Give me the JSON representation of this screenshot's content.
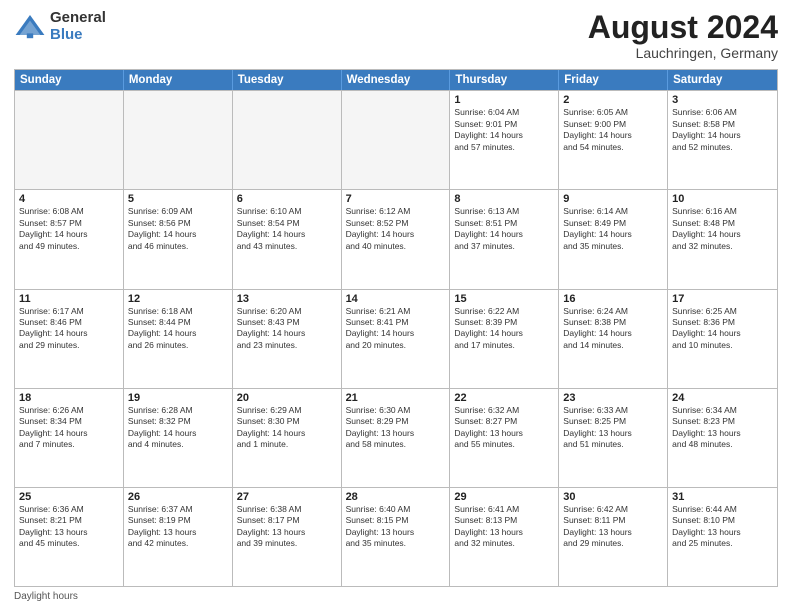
{
  "logo": {
    "general": "General",
    "blue": "Blue"
  },
  "title": {
    "month_year": "August 2024",
    "location": "Lauchringen, Germany"
  },
  "header_days": [
    "Sunday",
    "Monday",
    "Tuesday",
    "Wednesday",
    "Thursday",
    "Friday",
    "Saturday"
  ],
  "weeks": [
    [
      {
        "day": "",
        "info": "",
        "empty": true
      },
      {
        "day": "",
        "info": "",
        "empty": true
      },
      {
        "day": "",
        "info": "",
        "empty": true
      },
      {
        "day": "",
        "info": "",
        "empty": true
      },
      {
        "day": "1",
        "info": "Sunrise: 6:04 AM\nSunset: 9:01 PM\nDaylight: 14 hours\nand 57 minutes."
      },
      {
        "day": "2",
        "info": "Sunrise: 6:05 AM\nSunset: 9:00 PM\nDaylight: 14 hours\nand 54 minutes."
      },
      {
        "day": "3",
        "info": "Sunrise: 6:06 AM\nSunset: 8:58 PM\nDaylight: 14 hours\nand 52 minutes."
      }
    ],
    [
      {
        "day": "4",
        "info": "Sunrise: 6:08 AM\nSunset: 8:57 PM\nDaylight: 14 hours\nand 49 minutes."
      },
      {
        "day": "5",
        "info": "Sunrise: 6:09 AM\nSunset: 8:56 PM\nDaylight: 14 hours\nand 46 minutes."
      },
      {
        "day": "6",
        "info": "Sunrise: 6:10 AM\nSunset: 8:54 PM\nDaylight: 14 hours\nand 43 minutes."
      },
      {
        "day": "7",
        "info": "Sunrise: 6:12 AM\nSunset: 8:52 PM\nDaylight: 14 hours\nand 40 minutes."
      },
      {
        "day": "8",
        "info": "Sunrise: 6:13 AM\nSunset: 8:51 PM\nDaylight: 14 hours\nand 37 minutes."
      },
      {
        "day": "9",
        "info": "Sunrise: 6:14 AM\nSunset: 8:49 PM\nDaylight: 14 hours\nand 35 minutes."
      },
      {
        "day": "10",
        "info": "Sunrise: 6:16 AM\nSunset: 8:48 PM\nDaylight: 14 hours\nand 32 minutes."
      }
    ],
    [
      {
        "day": "11",
        "info": "Sunrise: 6:17 AM\nSunset: 8:46 PM\nDaylight: 14 hours\nand 29 minutes."
      },
      {
        "day": "12",
        "info": "Sunrise: 6:18 AM\nSunset: 8:44 PM\nDaylight: 14 hours\nand 26 minutes."
      },
      {
        "day": "13",
        "info": "Sunrise: 6:20 AM\nSunset: 8:43 PM\nDaylight: 14 hours\nand 23 minutes."
      },
      {
        "day": "14",
        "info": "Sunrise: 6:21 AM\nSunset: 8:41 PM\nDaylight: 14 hours\nand 20 minutes."
      },
      {
        "day": "15",
        "info": "Sunrise: 6:22 AM\nSunset: 8:39 PM\nDaylight: 14 hours\nand 17 minutes."
      },
      {
        "day": "16",
        "info": "Sunrise: 6:24 AM\nSunset: 8:38 PM\nDaylight: 14 hours\nand 14 minutes."
      },
      {
        "day": "17",
        "info": "Sunrise: 6:25 AM\nSunset: 8:36 PM\nDaylight: 14 hours\nand 10 minutes."
      }
    ],
    [
      {
        "day": "18",
        "info": "Sunrise: 6:26 AM\nSunset: 8:34 PM\nDaylight: 14 hours\nand 7 minutes."
      },
      {
        "day": "19",
        "info": "Sunrise: 6:28 AM\nSunset: 8:32 PM\nDaylight: 14 hours\nand 4 minutes."
      },
      {
        "day": "20",
        "info": "Sunrise: 6:29 AM\nSunset: 8:30 PM\nDaylight: 14 hours\nand 1 minute."
      },
      {
        "day": "21",
        "info": "Sunrise: 6:30 AM\nSunset: 8:29 PM\nDaylight: 13 hours\nand 58 minutes."
      },
      {
        "day": "22",
        "info": "Sunrise: 6:32 AM\nSunset: 8:27 PM\nDaylight: 13 hours\nand 55 minutes."
      },
      {
        "day": "23",
        "info": "Sunrise: 6:33 AM\nSunset: 8:25 PM\nDaylight: 13 hours\nand 51 minutes."
      },
      {
        "day": "24",
        "info": "Sunrise: 6:34 AM\nSunset: 8:23 PM\nDaylight: 13 hours\nand 48 minutes."
      }
    ],
    [
      {
        "day": "25",
        "info": "Sunrise: 6:36 AM\nSunset: 8:21 PM\nDaylight: 13 hours\nand 45 minutes."
      },
      {
        "day": "26",
        "info": "Sunrise: 6:37 AM\nSunset: 8:19 PM\nDaylight: 13 hours\nand 42 minutes."
      },
      {
        "day": "27",
        "info": "Sunrise: 6:38 AM\nSunset: 8:17 PM\nDaylight: 13 hours\nand 39 minutes."
      },
      {
        "day": "28",
        "info": "Sunrise: 6:40 AM\nSunset: 8:15 PM\nDaylight: 13 hours\nand 35 minutes."
      },
      {
        "day": "29",
        "info": "Sunrise: 6:41 AM\nSunset: 8:13 PM\nDaylight: 13 hours\nand 32 minutes."
      },
      {
        "day": "30",
        "info": "Sunrise: 6:42 AM\nSunset: 8:11 PM\nDaylight: 13 hours\nand 29 minutes."
      },
      {
        "day": "31",
        "info": "Sunrise: 6:44 AM\nSunset: 8:10 PM\nDaylight: 13 hours\nand 25 minutes."
      }
    ]
  ],
  "footer": {
    "note": "Daylight hours"
  }
}
